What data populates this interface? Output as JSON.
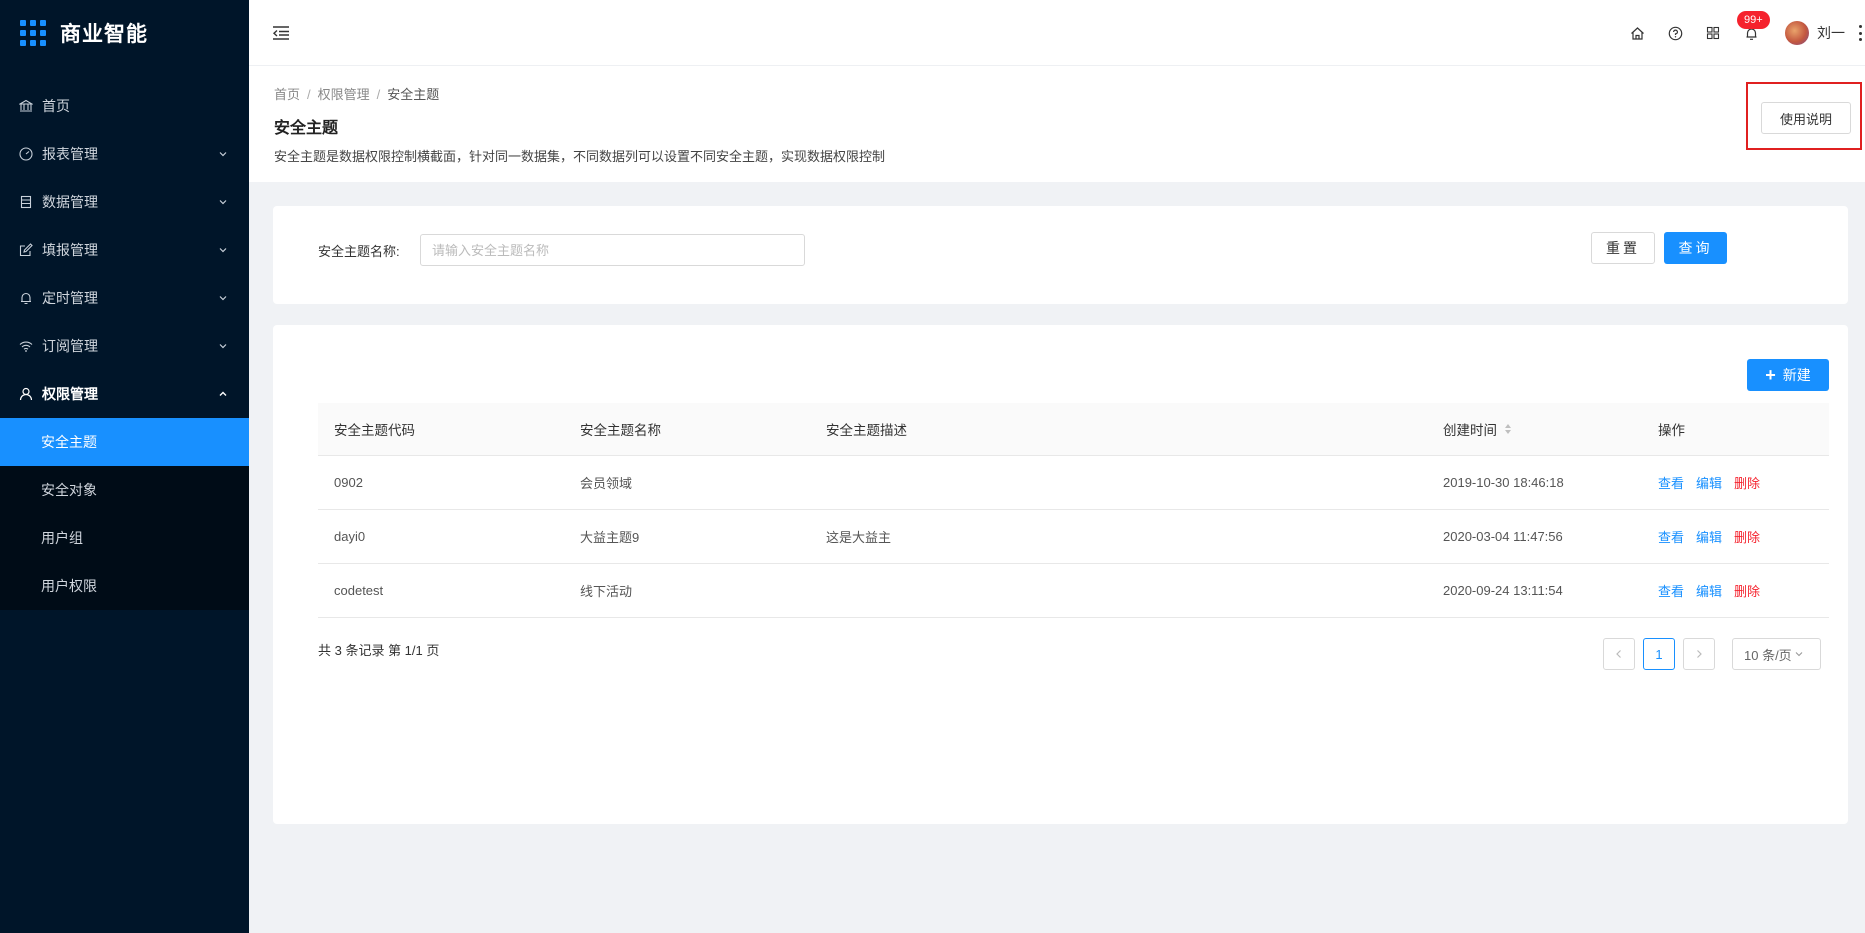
{
  "app": {
    "title": "商业智能"
  },
  "sidebar": {
    "items": [
      {
        "label": "首页",
        "icon": "bank-icon",
        "expandable": false
      },
      {
        "label": "报表管理",
        "icon": "dashboard-icon",
        "expandable": true
      },
      {
        "label": "数据管理",
        "icon": "database-icon",
        "expandable": true
      },
      {
        "label": "填报管理",
        "icon": "form-icon",
        "expandable": true
      },
      {
        "label": "定时管理",
        "icon": "bell-icon",
        "expandable": true
      },
      {
        "label": "订阅管理",
        "icon": "wifi-icon",
        "expandable": true
      },
      {
        "label": "权限管理",
        "icon": "user-icon",
        "expandable": true,
        "open": true
      }
    ],
    "sub_items": [
      {
        "label": "安全主题",
        "active": true
      },
      {
        "label": "安全对象"
      },
      {
        "label": "用户组"
      },
      {
        "label": "用户权限"
      }
    ]
  },
  "header": {
    "notification_badge": "99+",
    "user_name": "刘一"
  },
  "page": {
    "breadcrumb": [
      "首页",
      "权限管理",
      "安全主题"
    ],
    "title": "安全主题",
    "description": "安全主题是数据权限控制横截面，针对同一数据集，不同数据列可以设置不同安全主题，实现数据权限控制",
    "help_button": "使用说明"
  },
  "search": {
    "label": "安全主题名称:",
    "placeholder": "请输入安全主题名称",
    "value": "",
    "reset_label": "重置",
    "query_label": "查询"
  },
  "table": {
    "new_button": "新建",
    "columns": [
      "安全主题代码",
      "安全主题名称",
      "安全主题描述",
      "创建时间",
      "操作"
    ],
    "rows": [
      {
        "code": "0902",
        "name": "会员领域",
        "desc": "",
        "created": "2019-10-30 18:46:18"
      },
      {
        "code": "dayi0",
        "name": "大益主题9",
        "desc": "这是大益主",
        "created": "2020-03-04 11:47:56"
      },
      {
        "code": "codetest",
        "name": "线下活动",
        "desc": "",
        "created": "2020-09-24 13:11:54"
      }
    ],
    "actions": {
      "view": "查看",
      "edit": "编辑",
      "delete": "删除"
    }
  },
  "pagination": {
    "summary": "共 3 条记录 第 1/1 页",
    "current_page": "1",
    "page_size": "10 条/页"
  },
  "colors": {
    "primary": "#1890ff",
    "danger": "#f5222d",
    "sidebar_bg": "#001529",
    "highlight_outline": "#e02020"
  }
}
